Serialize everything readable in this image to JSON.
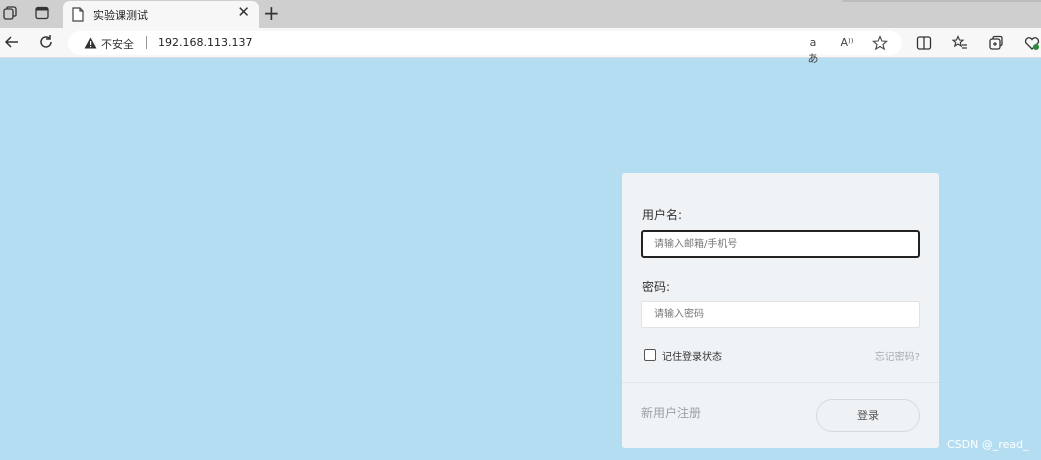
{
  "browser": {
    "tab": {
      "title": "实验课测试",
      "close": "✕"
    },
    "new_tab": "+",
    "address": {
      "security_label": "不安全",
      "url": "192.168.113.137"
    },
    "omnibox_icons": [
      "translate-icon",
      "read-aloud-icon",
      "favorite-star-icon"
    ],
    "translate_glyph": "aあ",
    "read_aloud_glyph": "A⁾⁾"
  },
  "login": {
    "username_label": "用户名:",
    "username_placeholder": "请输入邮箱/手机号",
    "password_label": "密码:",
    "password_placeholder": "请输入密码",
    "remember_label": "记住登录状态",
    "forgot_link": "忘记密码?",
    "register_link": "新用户注册",
    "submit_label": "登录"
  },
  "watermark": "CSDN @_read_",
  "colors": {
    "page_bg": "#b5ddf1",
    "card_bg": "#eff3f6"
  }
}
